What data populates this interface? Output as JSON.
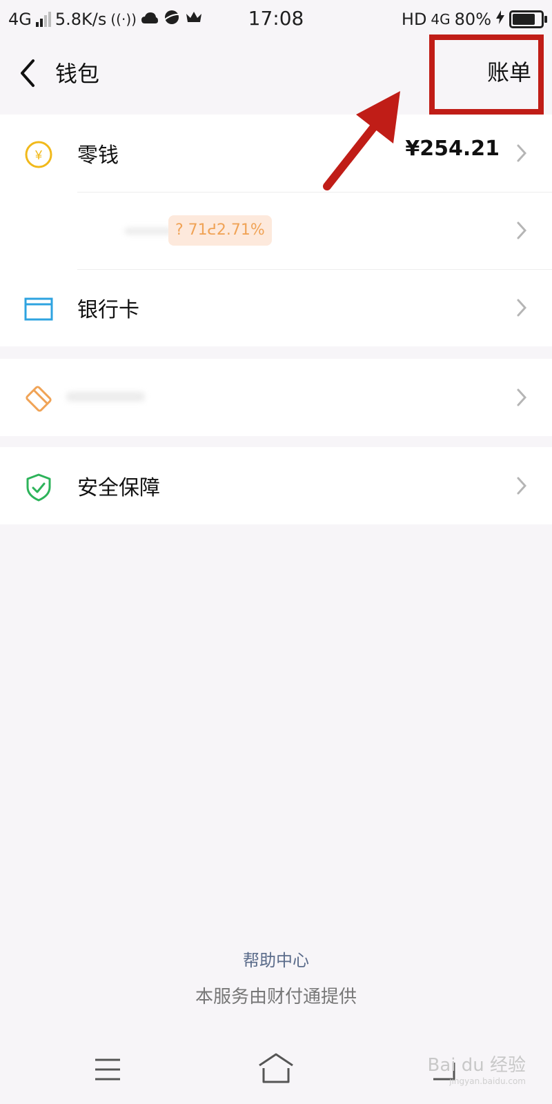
{
  "status_bar": {
    "network": "4G",
    "speed": "5.8K/s",
    "time": "17:08",
    "hd": "HD",
    "net_right": "4G",
    "battery": "80%",
    "battery_level": 0.8
  },
  "header": {
    "title": "钱包",
    "bill_label": "账单"
  },
  "wallet": {
    "change_label": "零钱",
    "change_value": "¥254.21",
    "rate_badge": "? 71ᕍ2.71%",
    "bank_card_label": "银行卡"
  },
  "security": {
    "label": "安全保障"
  },
  "footer": {
    "help_link": "帮助中心",
    "provider": "本服务由财付通提供"
  },
  "watermark": {
    "text": "Bai du 经验",
    "url": "jingyan.baidu.com"
  },
  "colors": {
    "accent_yellow": "#f1b91b",
    "card_blue": "#2ea3e0",
    "orange": "#f0a356",
    "green": "#2db35a",
    "annotation_red": "#c01d17",
    "link_blue": "#5a6b8a",
    "background": "#f7f5f8"
  },
  "icons": {
    "change": "yen-coin-icon",
    "bank_card": "bank-card-icon",
    "blurred_item": "diamond-tag-icon",
    "security": "shield-check-icon"
  }
}
